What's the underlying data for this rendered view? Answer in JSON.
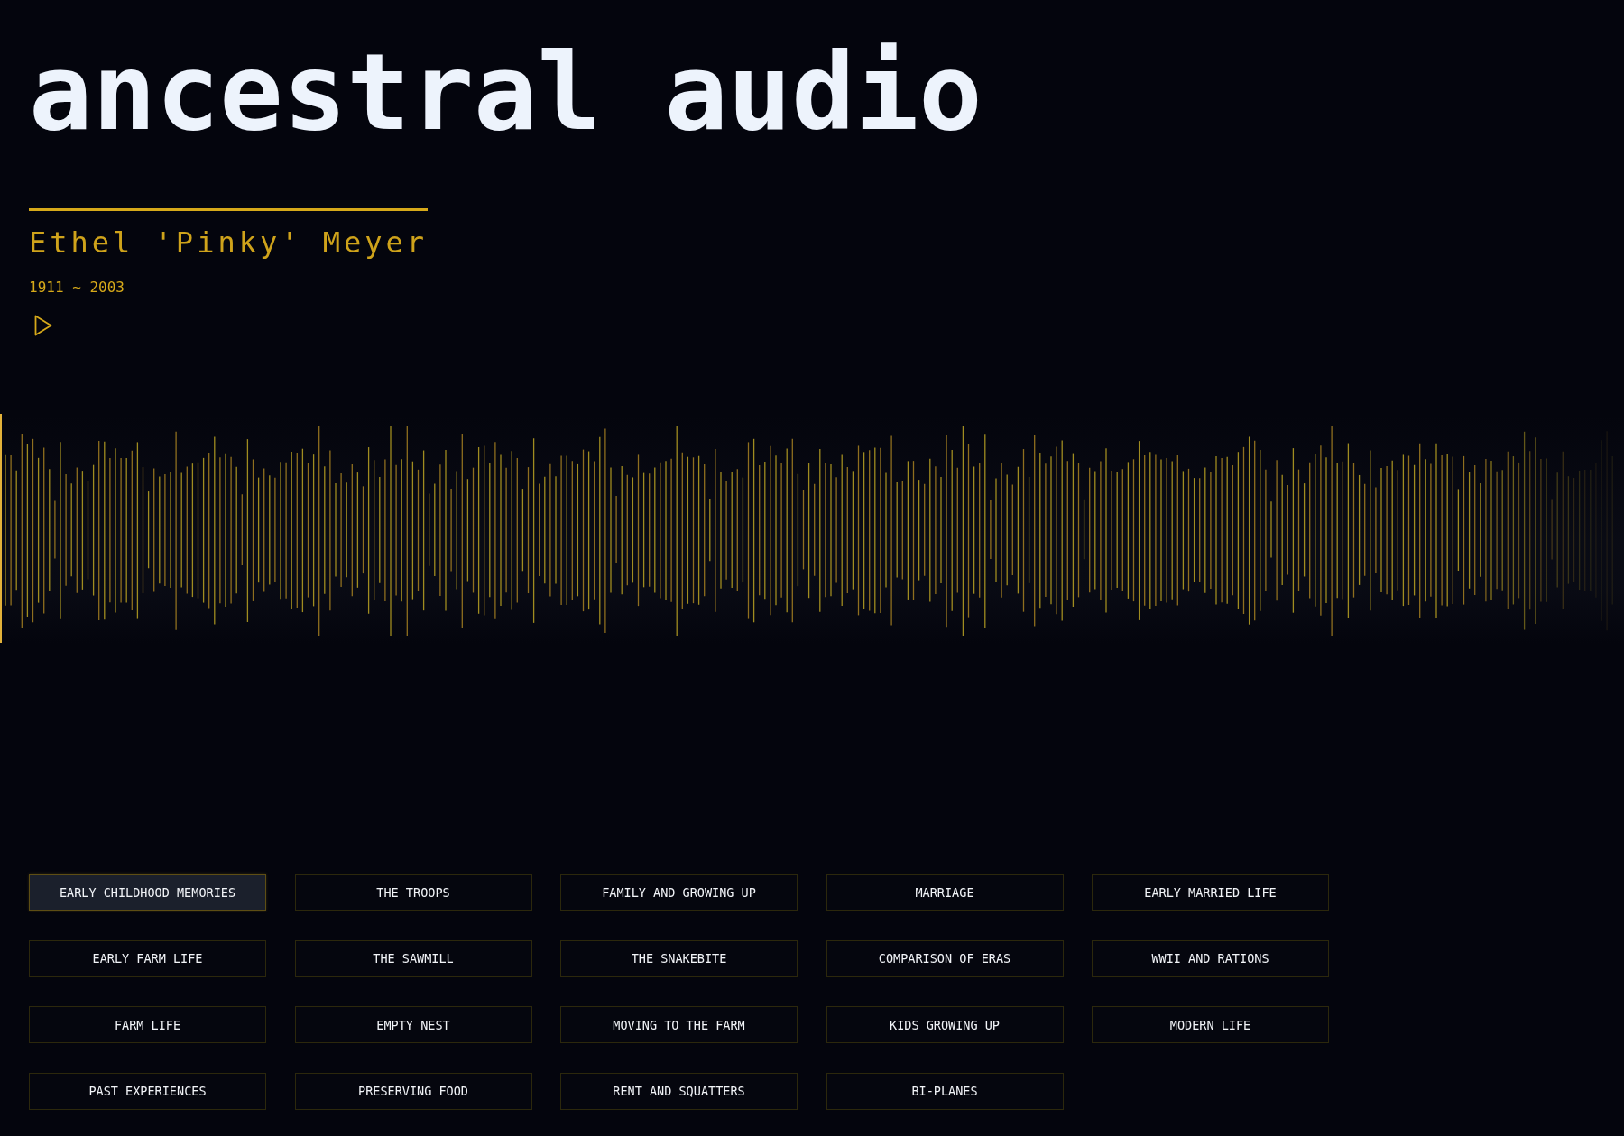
{
  "site": {
    "title": "ancestral audio"
  },
  "person": {
    "name": "Ethel 'Pinky' Meyer",
    "years": "1911 ~ 2003"
  },
  "player": {
    "playing": false,
    "level": 0
  },
  "topics": [
    {
      "label": "EARLY CHILDHOOD MEMORIES",
      "selected": true
    },
    {
      "label": "THE TROOPS",
      "selected": false
    },
    {
      "label": "FAMILY AND GROWING UP",
      "selected": false
    },
    {
      "label": "MARRIAGE",
      "selected": false
    },
    {
      "label": "EARLY MARRIED LIFE",
      "selected": false
    },
    {
      "label": "EARLY FARM LIFE",
      "selected": false
    },
    {
      "label": "THE SAWMILL",
      "selected": false
    },
    {
      "label": "THE SNAKEBITE",
      "selected": false
    },
    {
      "label": "COMPARISON OF ERAS",
      "selected": false
    },
    {
      "label": "WWII AND RATIONS",
      "selected": false
    },
    {
      "label": "FARM LIFE",
      "selected": false
    },
    {
      "label": "EMPTY NEST",
      "selected": false
    },
    {
      "label": "MOVING TO THE FARM",
      "selected": false
    },
    {
      "label": "KIDS GROWING UP",
      "selected": false
    },
    {
      "label": "MODERN LIFE",
      "selected": false
    },
    {
      "label": "PAST EXPERIENCES",
      "selected": false
    },
    {
      "label": "PRESERVING FOOD",
      "selected": false
    },
    {
      "label": "RENT AND SQUATTERS",
      "selected": false
    },
    {
      "label": "BI-PLANES",
      "selected": false
    }
  ]
}
